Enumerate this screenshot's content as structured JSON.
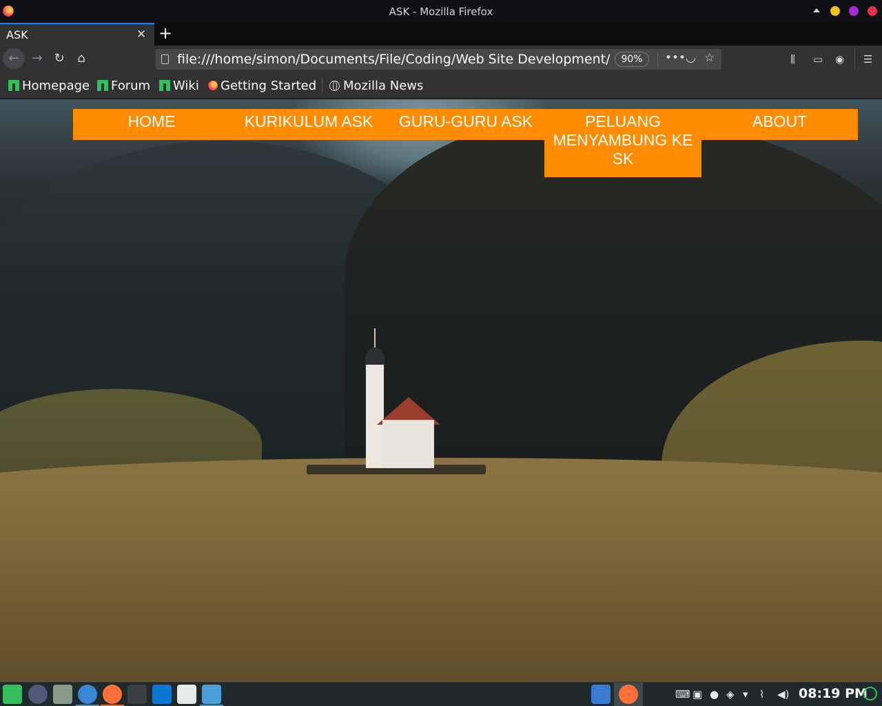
{
  "window": {
    "title": "ASK - Mozilla Firefox"
  },
  "tabs": [
    {
      "label": "ASK"
    }
  ],
  "toolbar": {
    "url": "file:///home/simon/Documents/File/Coding/Web Site Development/F",
    "zoom": "90%"
  },
  "bookmarks": [
    {
      "label": "Homepage",
      "icon": "manjaro-icon"
    },
    {
      "label": "Forum",
      "icon": "manjaro-icon"
    },
    {
      "label": "Wiki",
      "icon": "manjaro-icon"
    },
    {
      "label": "Getting Started",
      "icon": "firefox-icon"
    },
    {
      "label": "Mozilla News",
      "icon": "globe-icon"
    }
  ],
  "site_nav": {
    "items": [
      {
        "label": "HOME"
      },
      {
        "label": "KURIKULUM ASK"
      },
      {
        "label": "GURU-GURU ASK"
      },
      {
        "label": "PELUANG MENYAMBUNG KE SK"
      },
      {
        "label": "ABOUT"
      }
    ],
    "color": "#ff8c00"
  },
  "taskbar": {
    "clock": "08:19 PM",
    "apps": [
      "manjaro-menu-icon",
      "dial-icon",
      "files-icon",
      "chromium-icon",
      "firefox-icon",
      "terminal-icon",
      "vscode-icon",
      "text-editor-icon",
      "image-editor-icon"
    ]
  }
}
